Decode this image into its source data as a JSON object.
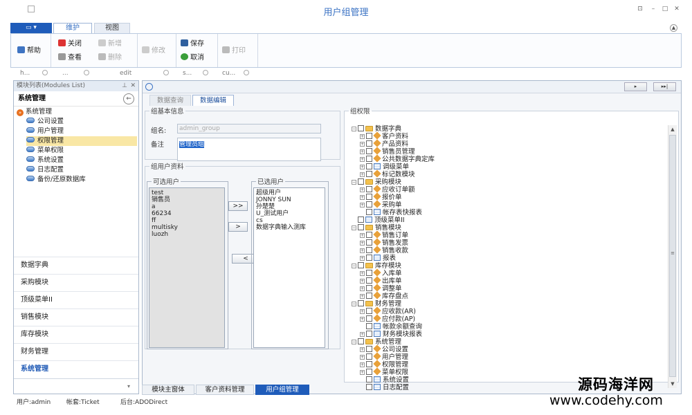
{
  "window": {
    "title": "用户组管理",
    "controls": [
      "⊡",
      "–",
      "□",
      "✕"
    ]
  },
  "ribbon": {
    "app_menu": "▭ ▾",
    "tabs": [
      {
        "label": "维护",
        "active": true
      },
      {
        "label": "视图",
        "active": false
      }
    ],
    "buttons": {
      "help": "帮助",
      "close": "关闭",
      "view": "查看",
      "new": "新增",
      "delete": "删除",
      "modify": "修改",
      "save": "保存",
      "cancel": "取消",
      "print": "打印"
    },
    "group_labels": [
      "h...",
      "...",
      "edit",
      "s...",
      "cu..."
    ]
  },
  "left_panel": {
    "header": "模块列表(Modules List)",
    "section_title": "系统管理",
    "tree_root": "系统管理",
    "tree_items": [
      {
        "label": "公司设置",
        "selected": false
      },
      {
        "label": "用户管理",
        "selected": false
      },
      {
        "label": "权限管理",
        "selected": true
      },
      {
        "label": "菜单权限",
        "selected": false
      },
      {
        "label": "系统设置",
        "selected": false
      },
      {
        "label": "日志配置",
        "selected": false
      },
      {
        "label": "备份/还原数据库",
        "selected": false
      }
    ],
    "nav_buttons": [
      {
        "label": "数据字典",
        "active": false
      },
      {
        "label": "采购模块",
        "active": false
      },
      {
        "label": "顶级菜单II",
        "active": false
      },
      {
        "label": "销售模块",
        "active": false
      },
      {
        "label": "库存模块",
        "active": false
      },
      {
        "label": "财务管理",
        "active": false
      },
      {
        "label": "系统管理",
        "active": true
      }
    ]
  },
  "main": {
    "nav_buttons": [
      "▸",
      "▸▸|"
    ],
    "subtabs": [
      {
        "label": "数据查询",
        "active": false
      },
      {
        "label": "数据编辑",
        "active": true
      }
    ],
    "group_info": {
      "legend": "组基本信息",
      "name_label": "组名:",
      "name_value": "admin_group",
      "note_label": "备注",
      "note_value": "管理员组"
    },
    "group_users": {
      "legend": "组用户资料",
      "available_label": "可选用户",
      "available": [
        "test",
        "销售员",
        "a",
        "66234",
        "ff",
        "multisky",
        "luozh"
      ],
      "selected_label": "已选用户",
      "selected": [
        "超级用户",
        "JONNY SUN",
        "孙楚楚",
        "U_测试用户",
        "cs",
        "数据字典输入测库"
      ],
      "btn_add_all": ">>",
      "btn_add": ">",
      "btn_remove": "<"
    },
    "permissions": {
      "legend": "组权限",
      "tree": [
        {
          "label": "数据字典",
          "level": 0,
          "icon": "folder",
          "expand": "−"
        },
        {
          "label": "客户资料",
          "level": 1,
          "icon": "diamond",
          "expand": "+"
        },
        {
          "label": "产品资料",
          "level": 1,
          "icon": "diamond",
          "expand": "+"
        },
        {
          "label": "销售员管理",
          "level": 1,
          "icon": "diamond",
          "expand": "+"
        },
        {
          "label": "公共数据字典定库",
          "level": 1,
          "icon": "diamond",
          "expand": "+"
        },
        {
          "label": "调级菜单",
          "level": 1,
          "icon": "grid",
          "expand": "+"
        },
        {
          "label": "标记数模块",
          "level": 1,
          "icon": "diamond",
          "expand": "+"
        },
        {
          "label": "采购模块",
          "level": 0,
          "icon": "folder",
          "expand": "−"
        },
        {
          "label": "应收订单额",
          "level": 1,
          "icon": "diamond",
          "expand": "+"
        },
        {
          "label": "报价单",
          "level": 1,
          "icon": "diamond",
          "expand": "+"
        },
        {
          "label": "采购单",
          "level": 1,
          "icon": "diamond",
          "expand": "+"
        },
        {
          "label": "帐存表快报表",
          "level": 1,
          "icon": "grid",
          "expand": ""
        },
        {
          "label": "顶级菜单II",
          "level": 0,
          "icon": "grid",
          "expand": ""
        },
        {
          "label": "销售模块",
          "level": 0,
          "icon": "folder",
          "expand": "−"
        },
        {
          "label": "销售订单",
          "level": 1,
          "icon": "diamond",
          "expand": "+"
        },
        {
          "label": "销售发票",
          "level": 1,
          "icon": "diamond",
          "expand": "+"
        },
        {
          "label": "销售收款",
          "level": 1,
          "icon": "diamond",
          "expand": "+"
        },
        {
          "label": "报表",
          "level": 1,
          "icon": "grid",
          "expand": "+"
        },
        {
          "label": "库存模块",
          "level": 0,
          "icon": "folder",
          "expand": "−"
        },
        {
          "label": "入库单",
          "level": 1,
          "icon": "diamond",
          "expand": "+"
        },
        {
          "label": "出库单",
          "level": 1,
          "icon": "diamond",
          "expand": "+"
        },
        {
          "label": "调整单",
          "level": 1,
          "icon": "diamond",
          "expand": "+"
        },
        {
          "label": "库存盘点",
          "level": 1,
          "icon": "diamond",
          "expand": "+"
        },
        {
          "label": "财务管理",
          "level": 0,
          "icon": "folder",
          "expand": "−"
        },
        {
          "label": "应收款(AR)",
          "level": 1,
          "icon": "diamond",
          "expand": "+"
        },
        {
          "label": "应付款(AP)",
          "level": 1,
          "icon": "diamond",
          "expand": "+"
        },
        {
          "label": "帐款余额查询",
          "level": 1,
          "icon": "grid",
          "expand": ""
        },
        {
          "label": "财务模块报表",
          "level": 1,
          "icon": "grid",
          "expand": "+"
        },
        {
          "label": "系统管理",
          "level": 0,
          "icon": "folder",
          "expand": "−"
        },
        {
          "label": "公司设置",
          "level": 1,
          "icon": "diamond",
          "expand": "+"
        },
        {
          "label": "用户管理",
          "level": 1,
          "icon": "diamond",
          "expand": "+"
        },
        {
          "label": "权限管理",
          "level": 1,
          "icon": "diamond",
          "expand": "+"
        },
        {
          "label": "菜单权限",
          "level": 1,
          "icon": "diamond",
          "expand": "+"
        },
        {
          "label": "系统设置",
          "level": 1,
          "icon": "grid",
          "expand": ""
        },
        {
          "label": "日志配置",
          "level": 1,
          "icon": "grid",
          "expand": ""
        }
      ]
    }
  },
  "doc_tabs": [
    {
      "label": "模块主窗体",
      "active": false
    },
    {
      "label": "客户资料管理",
      "active": false
    },
    {
      "label": "用户组管理",
      "active": true
    }
  ],
  "status": {
    "user": "用户:admin",
    "account": "帐套:Ticket",
    "backend": "后台:ADODirect"
  },
  "watermark": {
    "line1": "源码海洋网",
    "line2": "www.codehy.com"
  }
}
